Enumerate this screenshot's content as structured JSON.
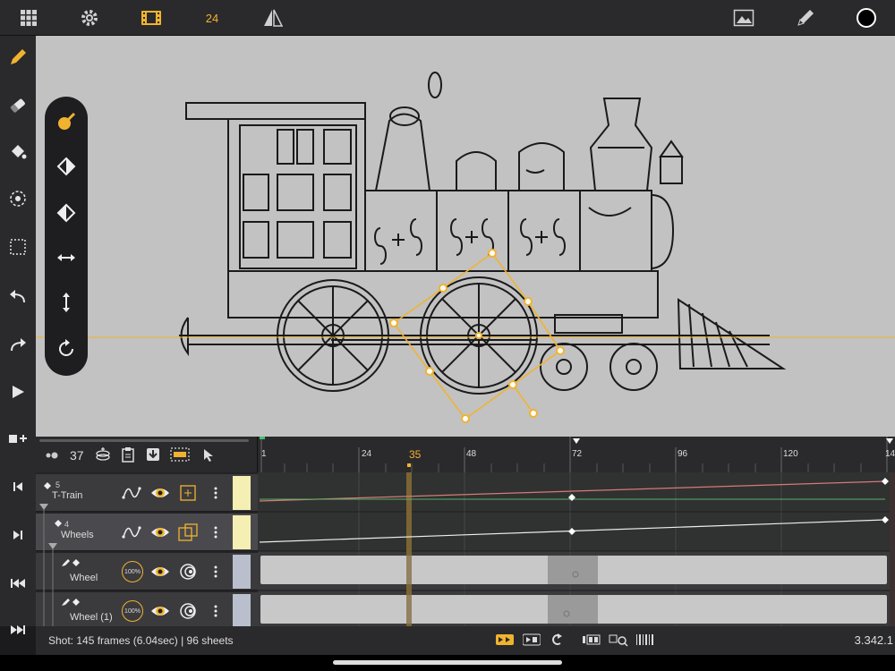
{
  "topbar": {
    "frame_rate": "24",
    "icons": [
      "grid-icon",
      "gear-icon",
      "filmstrip-icon",
      "mirror-icon",
      "image-icon",
      "pencil-icon",
      "color-swatch-icon"
    ]
  },
  "left_tools": [
    "pencil-icon",
    "eraser-icon",
    "paint-bucket-icon",
    "transform-icon",
    "select-rect-icon",
    "undo-icon",
    "redo-icon",
    "play-icon",
    "add-layer-icon",
    "first-frame-icon",
    "next-frame-icon",
    "rewind-icon",
    "fast-forward-icon"
  ],
  "palette_tools": [
    "brush-icon",
    "diamond-left-icon",
    "diamond-right-icon",
    "horizontal-arrow-icon",
    "vertical-arrow-icon",
    "rotate-icon"
  ],
  "timeline": {
    "frame_count_display": "37",
    "current_frame": "35",
    "ruler_ticks": [
      "1",
      "24",
      "48",
      "72",
      "96",
      "120",
      "14"
    ]
  },
  "layers": [
    {
      "number": "5",
      "name": "T-Train"
    },
    {
      "number": "4",
      "name": "Wheels"
    },
    {
      "name": "Wheel",
      "opacity": "100%"
    },
    {
      "name": "Wheel (1)",
      "opacity": "100%"
    }
  ],
  "status": {
    "shot_info": "Shot: 145 frames (6.04sec) | 96 sheets",
    "right_value": "3.342.1"
  },
  "colors": {
    "accent": "#f1b32f",
    "canvas": "#c2c2c2",
    "panel": "#2a2a2c"
  }
}
